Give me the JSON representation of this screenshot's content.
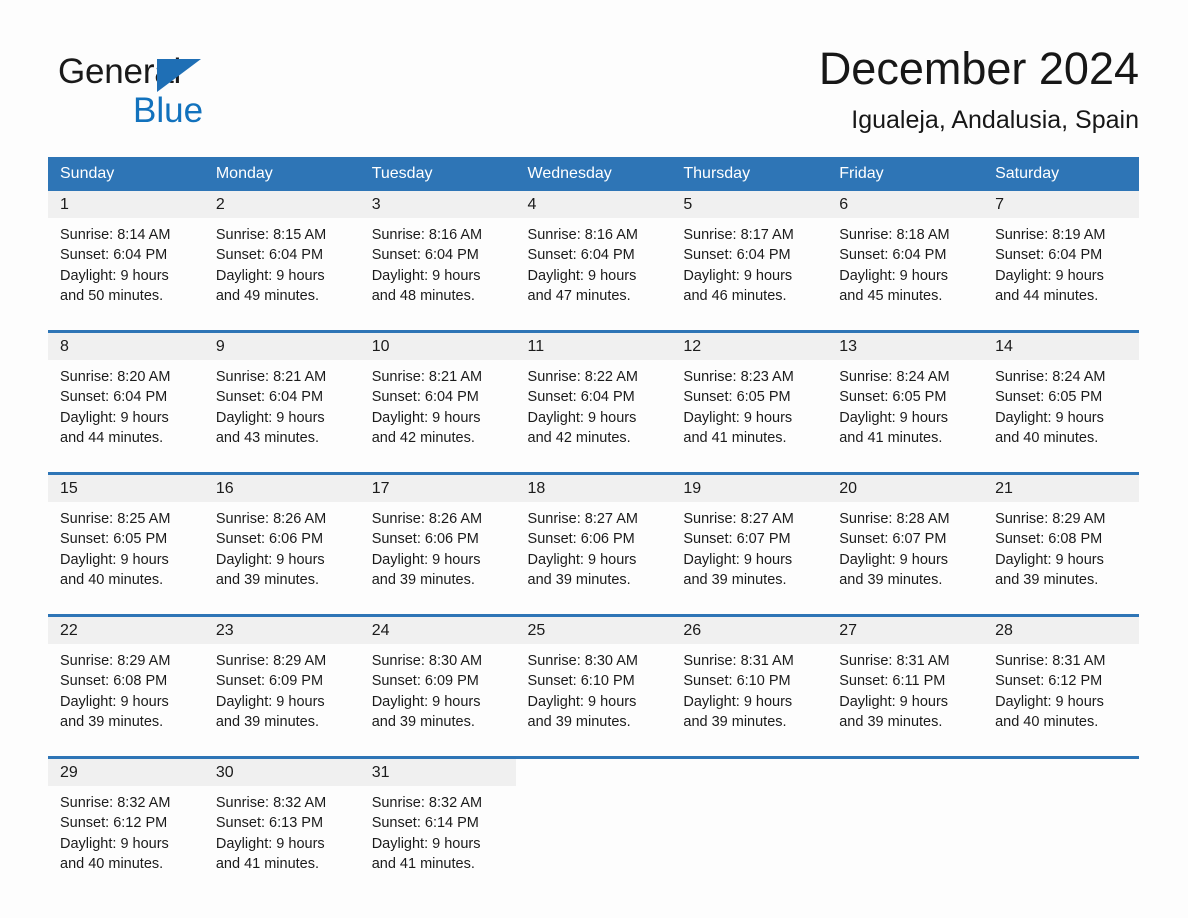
{
  "brand": {
    "word1": "General",
    "word2": "Blue",
    "triangle_color": "#1f6fb5",
    "blue_text_color": "#1272bd"
  },
  "header": {
    "title": "December 2024",
    "location": "Igualeja, Andalusia, Spain"
  },
  "theme": {
    "header_blue": "#2e75b6",
    "daynum_bg": "#f0f0f0",
    "page_bg": "#fdfdfd",
    "text": "#1b1b1b"
  },
  "weekday_headers": [
    "Sunday",
    "Monday",
    "Tuesday",
    "Wednesday",
    "Thursday",
    "Friday",
    "Saturday"
  ],
  "weeks": [
    [
      {
        "day": "1",
        "sunrise": "Sunrise: 8:14 AM",
        "sunset": "Sunset: 6:04 PM",
        "daylight1": "Daylight: 9 hours",
        "daylight2": "and 50 minutes."
      },
      {
        "day": "2",
        "sunrise": "Sunrise: 8:15 AM",
        "sunset": "Sunset: 6:04 PM",
        "daylight1": "Daylight: 9 hours",
        "daylight2": "and 49 minutes."
      },
      {
        "day": "3",
        "sunrise": "Sunrise: 8:16 AM",
        "sunset": "Sunset: 6:04 PM",
        "daylight1": "Daylight: 9 hours",
        "daylight2": "and 48 minutes."
      },
      {
        "day": "4",
        "sunrise": "Sunrise: 8:16 AM",
        "sunset": "Sunset: 6:04 PM",
        "daylight1": "Daylight: 9 hours",
        "daylight2": "and 47 minutes."
      },
      {
        "day": "5",
        "sunrise": "Sunrise: 8:17 AM",
        "sunset": "Sunset: 6:04 PM",
        "daylight1": "Daylight: 9 hours",
        "daylight2": "and 46 minutes."
      },
      {
        "day": "6",
        "sunrise": "Sunrise: 8:18 AM",
        "sunset": "Sunset: 6:04 PM",
        "daylight1": "Daylight: 9 hours",
        "daylight2": "and 45 minutes."
      },
      {
        "day": "7",
        "sunrise": "Sunrise: 8:19 AM",
        "sunset": "Sunset: 6:04 PM",
        "daylight1": "Daylight: 9 hours",
        "daylight2": "and 44 minutes."
      }
    ],
    [
      {
        "day": "8",
        "sunrise": "Sunrise: 8:20 AM",
        "sunset": "Sunset: 6:04 PM",
        "daylight1": "Daylight: 9 hours",
        "daylight2": "and 44 minutes."
      },
      {
        "day": "9",
        "sunrise": "Sunrise: 8:21 AM",
        "sunset": "Sunset: 6:04 PM",
        "daylight1": "Daylight: 9 hours",
        "daylight2": "and 43 minutes."
      },
      {
        "day": "10",
        "sunrise": "Sunrise: 8:21 AM",
        "sunset": "Sunset: 6:04 PM",
        "daylight1": "Daylight: 9 hours",
        "daylight2": "and 42 minutes."
      },
      {
        "day": "11",
        "sunrise": "Sunrise: 8:22 AM",
        "sunset": "Sunset: 6:04 PM",
        "daylight1": "Daylight: 9 hours",
        "daylight2": "and 42 minutes."
      },
      {
        "day": "12",
        "sunrise": "Sunrise: 8:23 AM",
        "sunset": "Sunset: 6:05 PM",
        "daylight1": "Daylight: 9 hours",
        "daylight2": "and 41 minutes."
      },
      {
        "day": "13",
        "sunrise": "Sunrise: 8:24 AM",
        "sunset": "Sunset: 6:05 PM",
        "daylight1": "Daylight: 9 hours",
        "daylight2": "and 41 minutes."
      },
      {
        "day": "14",
        "sunrise": "Sunrise: 8:24 AM",
        "sunset": "Sunset: 6:05 PM",
        "daylight1": "Daylight: 9 hours",
        "daylight2": "and 40 minutes."
      }
    ],
    [
      {
        "day": "15",
        "sunrise": "Sunrise: 8:25 AM",
        "sunset": "Sunset: 6:05 PM",
        "daylight1": "Daylight: 9 hours",
        "daylight2": "and 40 minutes."
      },
      {
        "day": "16",
        "sunrise": "Sunrise: 8:26 AM",
        "sunset": "Sunset: 6:06 PM",
        "daylight1": "Daylight: 9 hours",
        "daylight2": "and 39 minutes."
      },
      {
        "day": "17",
        "sunrise": "Sunrise: 8:26 AM",
        "sunset": "Sunset: 6:06 PM",
        "daylight1": "Daylight: 9 hours",
        "daylight2": "and 39 minutes."
      },
      {
        "day": "18",
        "sunrise": "Sunrise: 8:27 AM",
        "sunset": "Sunset: 6:06 PM",
        "daylight1": "Daylight: 9 hours",
        "daylight2": "and 39 minutes."
      },
      {
        "day": "19",
        "sunrise": "Sunrise: 8:27 AM",
        "sunset": "Sunset: 6:07 PM",
        "daylight1": "Daylight: 9 hours",
        "daylight2": "and 39 minutes."
      },
      {
        "day": "20",
        "sunrise": "Sunrise: 8:28 AM",
        "sunset": "Sunset: 6:07 PM",
        "daylight1": "Daylight: 9 hours",
        "daylight2": "and 39 minutes."
      },
      {
        "day": "21",
        "sunrise": "Sunrise: 8:29 AM",
        "sunset": "Sunset: 6:08 PM",
        "daylight1": "Daylight: 9 hours",
        "daylight2": "and 39 minutes."
      }
    ],
    [
      {
        "day": "22",
        "sunrise": "Sunrise: 8:29 AM",
        "sunset": "Sunset: 6:08 PM",
        "daylight1": "Daylight: 9 hours",
        "daylight2": "and 39 minutes."
      },
      {
        "day": "23",
        "sunrise": "Sunrise: 8:29 AM",
        "sunset": "Sunset: 6:09 PM",
        "daylight1": "Daylight: 9 hours",
        "daylight2": "and 39 minutes."
      },
      {
        "day": "24",
        "sunrise": "Sunrise: 8:30 AM",
        "sunset": "Sunset: 6:09 PM",
        "daylight1": "Daylight: 9 hours",
        "daylight2": "and 39 minutes."
      },
      {
        "day": "25",
        "sunrise": "Sunrise: 8:30 AM",
        "sunset": "Sunset: 6:10 PM",
        "daylight1": "Daylight: 9 hours",
        "daylight2": "and 39 minutes."
      },
      {
        "day": "26",
        "sunrise": "Sunrise: 8:31 AM",
        "sunset": "Sunset: 6:10 PM",
        "daylight1": "Daylight: 9 hours",
        "daylight2": "and 39 minutes."
      },
      {
        "day": "27",
        "sunrise": "Sunrise: 8:31 AM",
        "sunset": "Sunset: 6:11 PM",
        "daylight1": "Daylight: 9 hours",
        "daylight2": "and 39 minutes."
      },
      {
        "day": "28",
        "sunrise": "Sunrise: 8:31 AM",
        "sunset": "Sunset: 6:12 PM",
        "daylight1": "Daylight: 9 hours",
        "daylight2": "and 40 minutes."
      }
    ],
    [
      {
        "day": "29",
        "sunrise": "Sunrise: 8:32 AM",
        "sunset": "Sunset: 6:12 PM",
        "daylight1": "Daylight: 9 hours",
        "daylight2": "and 40 minutes."
      },
      {
        "day": "30",
        "sunrise": "Sunrise: 8:32 AM",
        "sunset": "Sunset: 6:13 PM",
        "daylight1": "Daylight: 9 hours",
        "daylight2": "and 41 minutes."
      },
      {
        "day": "31",
        "sunrise": "Sunrise: 8:32 AM",
        "sunset": "Sunset: 6:14 PM",
        "daylight1": "Daylight: 9 hours",
        "daylight2": "and 41 minutes."
      },
      {
        "day": "",
        "sunrise": "",
        "sunset": "",
        "daylight1": "",
        "daylight2": "",
        "blank": true
      },
      {
        "day": "",
        "sunrise": "",
        "sunset": "",
        "daylight1": "",
        "daylight2": "",
        "blank": true
      },
      {
        "day": "",
        "sunrise": "",
        "sunset": "",
        "daylight1": "",
        "daylight2": "",
        "blank": true
      },
      {
        "day": "",
        "sunrise": "",
        "sunset": "",
        "daylight1": "",
        "daylight2": "",
        "blank": true
      }
    ]
  ]
}
